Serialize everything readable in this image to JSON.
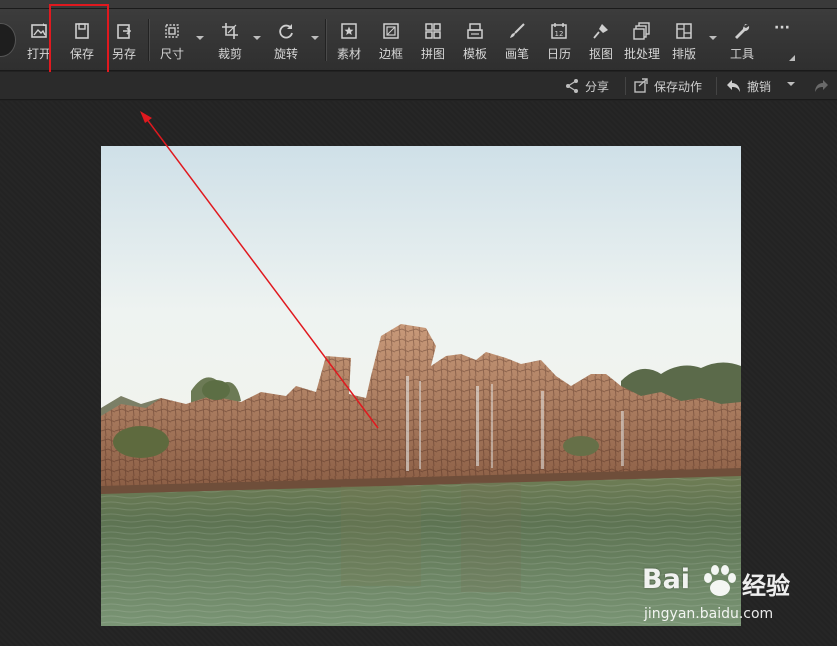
{
  "toolbar": {
    "items": [
      {
        "label": "打开",
        "icon": "open-image-icon"
      },
      {
        "label": "保存",
        "icon": "save-icon"
      },
      {
        "label": "另存",
        "icon": "save-as-icon"
      },
      {
        "label": "尺寸",
        "icon": "resize-icon"
      },
      {
        "label": "裁剪",
        "icon": "crop-icon"
      },
      {
        "label": "旋转",
        "icon": "rotate-icon"
      },
      {
        "label": "素材",
        "icon": "material-star-icon"
      },
      {
        "label": "边框",
        "icon": "border-frame-icon"
      },
      {
        "label": "拼图",
        "icon": "puzzle-grid-icon"
      },
      {
        "label": "模板",
        "icon": "template-icon"
      },
      {
        "label": "画笔",
        "icon": "brush-icon"
      },
      {
        "label": "日历",
        "icon": "calendar-icon"
      },
      {
        "label": "抠图",
        "icon": "cutout-pen-icon"
      },
      {
        "label": "批处理",
        "icon": "batch-icon"
      },
      {
        "label": "排版",
        "icon": "layout-icon"
      },
      {
        "label": "工具",
        "icon": "wrench-icon"
      }
    ],
    "more_label": "···",
    "calendar_number": "12"
  },
  "subbar": {
    "share_label": "分享",
    "save_action_label": "保存动作",
    "undo_label": "撤销"
  },
  "watermark": {
    "brand": "Bai",
    "brand_cn": "经验",
    "url": "jingyan.baidu.com"
  },
  "colors": {
    "highlight": "#e0191f",
    "arrow": "#e0191f"
  }
}
